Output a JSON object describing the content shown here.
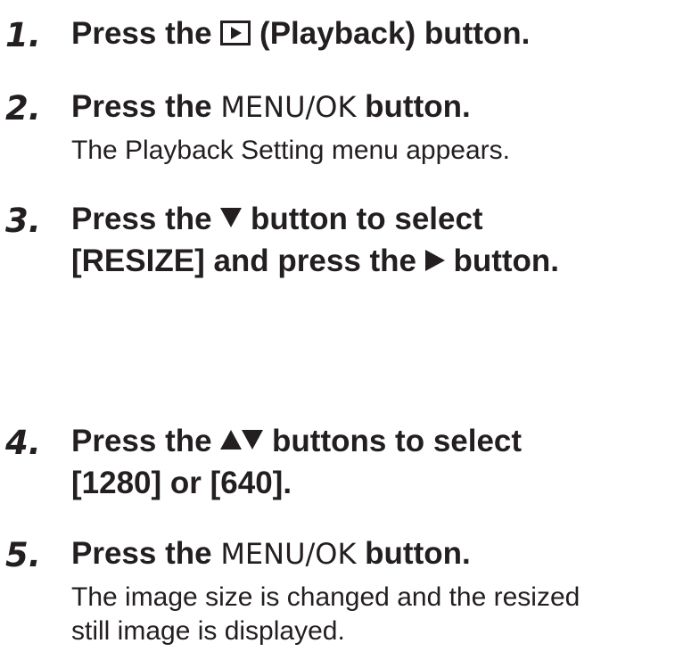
{
  "steps": [
    {
      "number": "1.",
      "prefix": "Press the ",
      "icon": "playback-icon",
      "suffix": " (Playback) button."
    },
    {
      "number": "2.",
      "prefix": "Press the ",
      "menu": "MENU/OK",
      "suffix": " button.",
      "note": "The Playback Setting menu appears."
    },
    {
      "number": "3.",
      "line1_prefix": "Press the ",
      "line1_icon": "down-arrow-icon",
      "line1_suffix": " button to select",
      "line2_prefix": "[RESIZE] and press the ",
      "line2_icon": "right-arrow-icon",
      "line2_suffix": " button."
    },
    {
      "number": "4.",
      "line1_prefix": "Press the ",
      "line1_icons": "up-down-arrow-icons",
      "line1_suffix": " buttons to select",
      "line2": "[1280] or [640]."
    },
    {
      "number": "5.",
      "prefix": "Press the ",
      "menu": "MENU/OK",
      "suffix": " button.",
      "note_line1": "The image size is changed and the resized",
      "note_line2": "still image is displayed."
    }
  ]
}
